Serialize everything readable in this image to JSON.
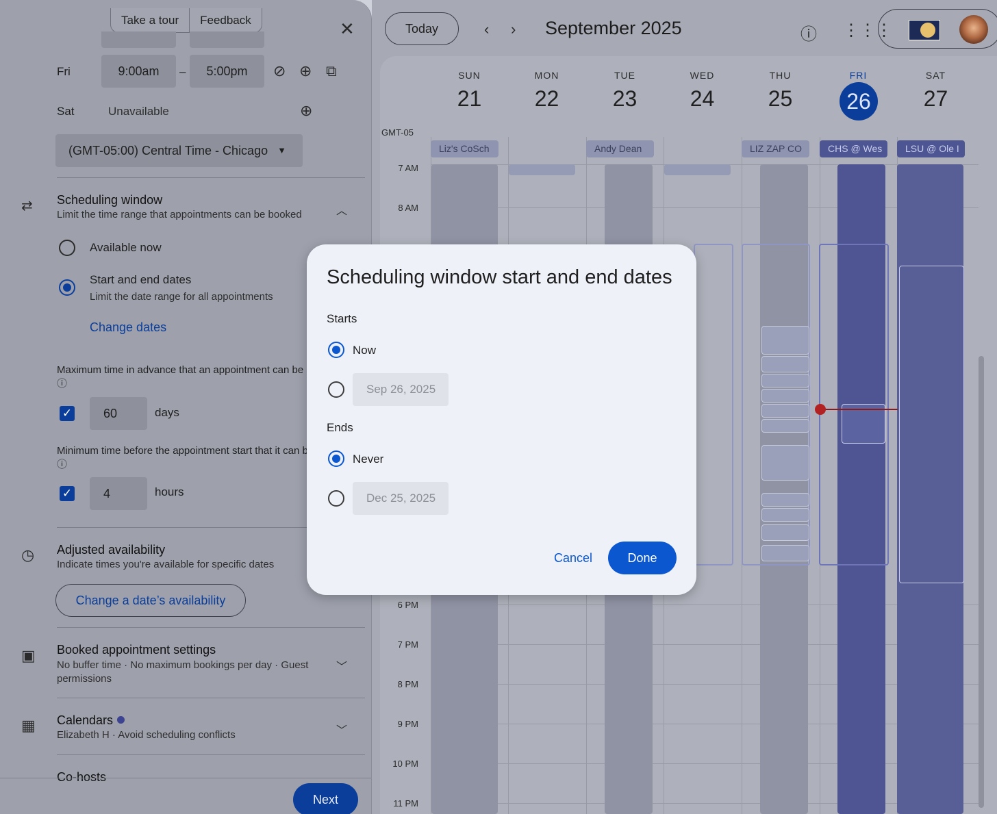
{
  "left_panel": {
    "top_buttons": [
      "Take a tour",
      "Feedback"
    ],
    "close_label": "✕",
    "fri": {
      "day": "Fri",
      "start": "9:00am",
      "end": "5:00pm",
      "dash": "–"
    },
    "sat": {
      "day": "Sat",
      "status": "Unavailable"
    },
    "timezone": "(GMT-05:00) Central Time - Chicago",
    "scheduling_window": {
      "title": "Scheduling window",
      "subtitle": "Limit the time range that appointments can be booked",
      "option_available_now": "Available now",
      "option_start_end": "Start and end dates",
      "option_start_end_sub": "Limit the date range for all appointments",
      "change_dates": "Change dates",
      "max_advance_label": "Maximum time in advance that an appointment can be booked",
      "max_advance_value": "60",
      "max_advance_unit": "days",
      "min_before_label": "Minimum time before the appointment start that it can be booked",
      "min_before_value": "4",
      "min_before_unit": "hours"
    },
    "adjusted": {
      "title": "Adjusted availability",
      "subtitle": "Indicate times you're available for specific dates",
      "button": "Change a date’s availability"
    },
    "booked": {
      "title": "Booked appointment settings",
      "subtitle": "No buffer time · No maximum bookings per day · Guest permissions"
    },
    "calendars": {
      "title": "Calendars",
      "subtitle": "Elizabeth H · Avoid scheduling conflicts"
    },
    "cohosts": {
      "title": "Co-hosts"
    },
    "next_button": "Next"
  },
  "calendar": {
    "today_button": "Today",
    "month_title": "September 2025",
    "timezone_label": "GMT-05",
    "days": [
      {
        "name": "SUN",
        "num": "21"
      },
      {
        "name": "MON",
        "num": "22"
      },
      {
        "name": "TUE",
        "num": "23"
      },
      {
        "name": "WED",
        "num": "24"
      },
      {
        "name": "THU",
        "num": "25"
      },
      {
        "name": "FRI",
        "num": "26"
      },
      {
        "name": "SAT",
        "num": "27"
      }
    ],
    "hours": [
      "7 AM",
      "8 AM",
      "6 PM",
      "7 PM",
      "8 PM",
      "9 PM",
      "10 PM",
      "11 PM"
    ],
    "all_day_events": [
      "Liz's CoSch",
      "Andy Dean",
      "LIZ ZAP CO",
      "CHS @ Wes",
      "LSU @ Ole I"
    ]
  },
  "modal": {
    "title": "Scheduling window start and end dates",
    "starts_label": "Starts",
    "starts_now": "Now",
    "starts_date": "Sep 26, 2025",
    "ends_label": "Ends",
    "ends_never": "Never",
    "ends_date": "Dec 25, 2025",
    "cancel": "Cancel",
    "done": "Done"
  },
  "colors": {
    "primary_blue": "#0b57d0",
    "today_blue": "#0b3e9a",
    "event_indigo": "#4d5593",
    "now_line": "#b22222"
  }
}
